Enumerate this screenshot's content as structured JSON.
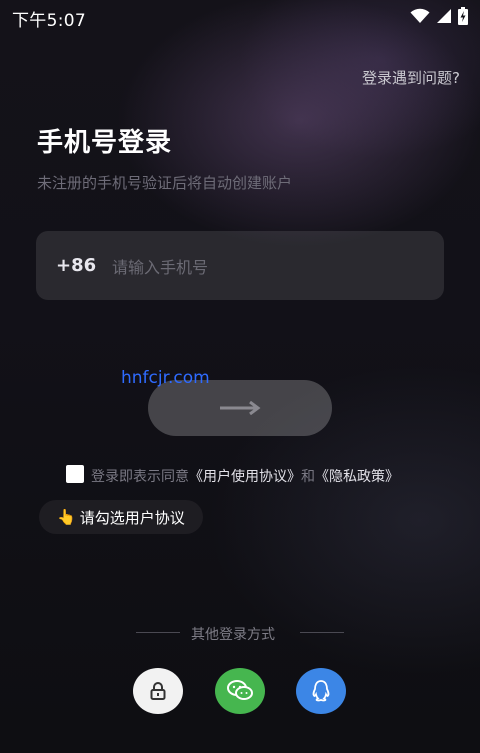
{
  "status_bar": {
    "time": "下午5:07"
  },
  "header": {
    "help_link": "登录遇到问题?"
  },
  "login": {
    "title": "手机号登录",
    "subtitle": "未注册的手机号验证后将自动创建账户",
    "country_code": "+86",
    "phone_placeholder": "请输入手机号",
    "phone_value": ""
  },
  "watermark": "hnfcjr.com",
  "agreement": {
    "prefix": "登录即表示同意",
    "user_agreement": "《用户使用协议》",
    "conjunction": "和",
    "privacy_policy": "《隐私政策》",
    "checked": false
  },
  "tip": {
    "icon": "👆",
    "text": "请勾选用户协议"
  },
  "other_login": {
    "label": "其他登录方式",
    "methods": [
      {
        "name": "password",
        "icon": "lock-icon",
        "color": "#f2f2f2"
      },
      {
        "name": "wechat",
        "icon": "wechat-icon",
        "color": "#46b64f"
      },
      {
        "name": "qq",
        "icon": "qq-icon",
        "color": "#3c86e6"
      }
    ]
  }
}
